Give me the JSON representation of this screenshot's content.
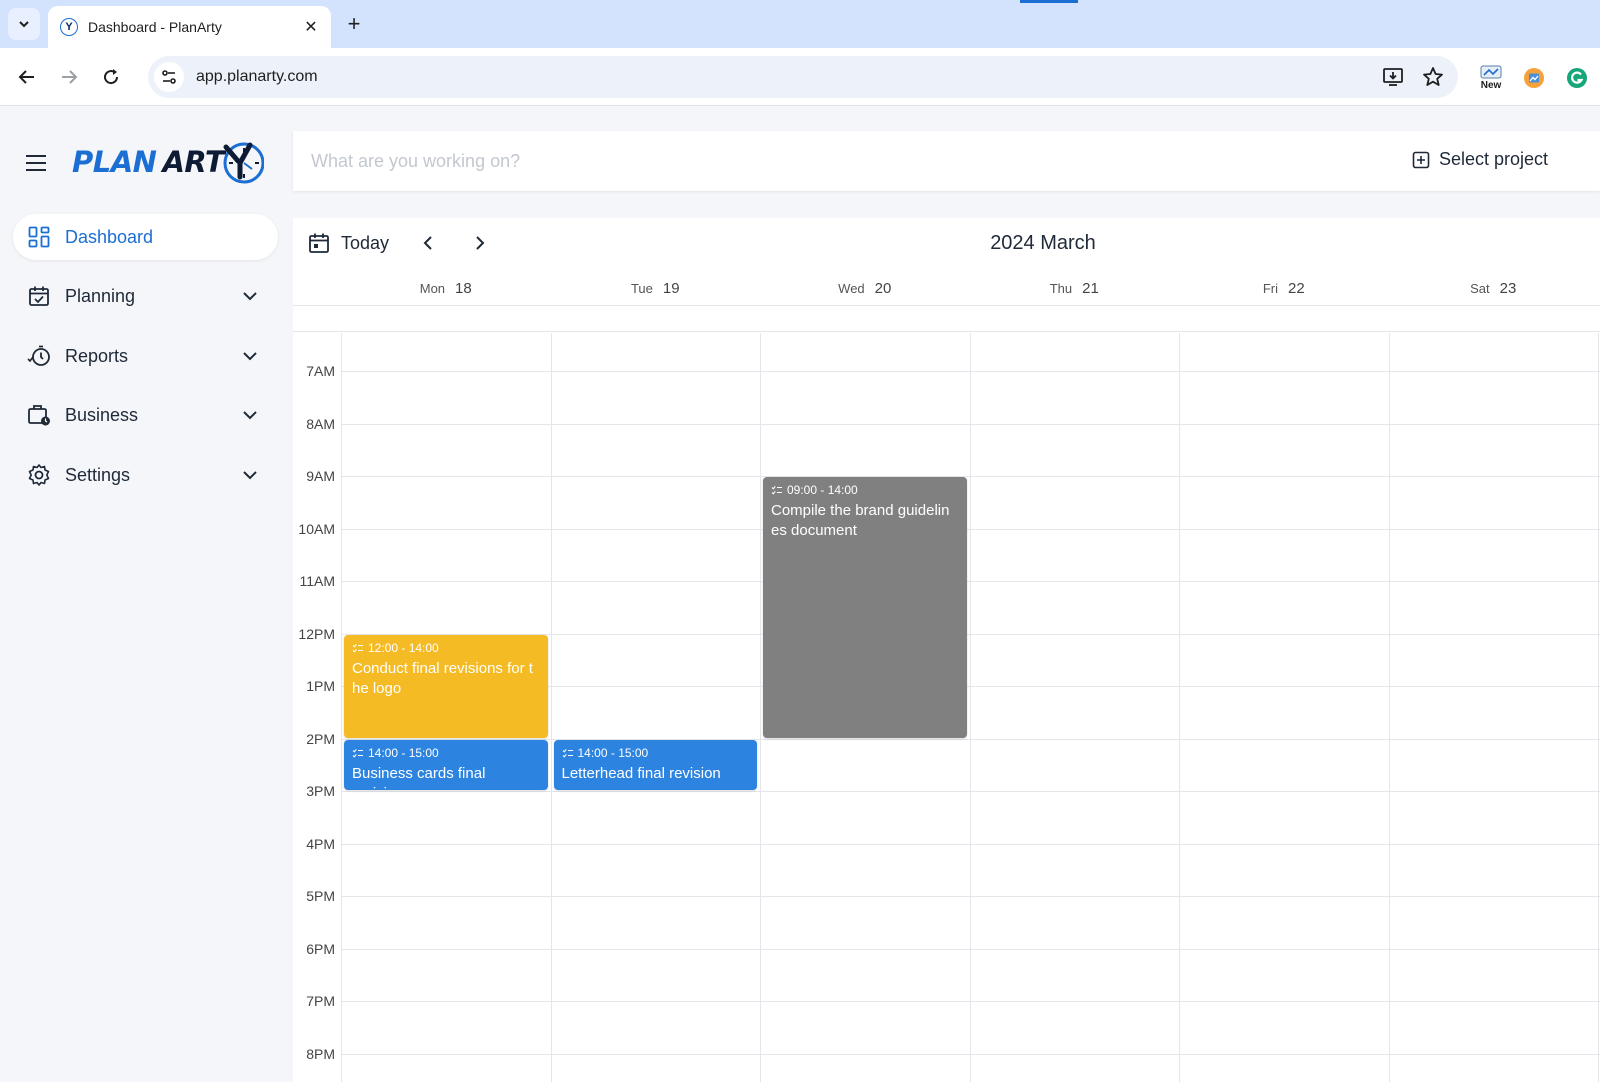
{
  "browser": {
    "tab_title": "Dashboard - PlanArty",
    "favicon_letter": "Y",
    "url": "app.planarty.com",
    "ext_new_label": "New"
  },
  "sidebar": {
    "logo_plan": "PLAN",
    "logo_arty": "ART",
    "items": [
      {
        "label": "Dashboard",
        "icon": "dashboard-icon",
        "active": true
      },
      {
        "label": "Planning",
        "icon": "calendar-check-icon"
      },
      {
        "label": "Reports",
        "icon": "stopwatch-icon"
      },
      {
        "label": "Business",
        "icon": "briefcase-clock-icon"
      },
      {
        "label": "Settings",
        "icon": "gear-icon"
      }
    ]
  },
  "timer": {
    "placeholder": "What are you working on?",
    "select_project": "Select project"
  },
  "calendar": {
    "today_label": "Today",
    "month_title": "2024 March",
    "days": [
      {
        "name": "Mon",
        "num": "18"
      },
      {
        "name": "Tue",
        "num": "19"
      },
      {
        "name": "Wed",
        "num": "20"
      },
      {
        "name": "Thu",
        "num": "21"
      },
      {
        "name": "Fri",
        "num": "22"
      },
      {
        "name": "Sat",
        "num": "23"
      }
    ],
    "hours": [
      "7AM",
      "8AM",
      "9AM",
      "10AM",
      "11AM",
      "12PM",
      "1PM",
      "2PM",
      "3PM",
      "4PM",
      "5PM",
      "6PM",
      "7PM",
      "8PM"
    ],
    "events": [
      {
        "day": 2,
        "start": 9,
        "end": 14,
        "time": "09:00 - 14:00",
        "title": "Compile the brand guidelin es document",
        "color": "#808080"
      },
      {
        "day": 0,
        "start": 12,
        "end": 14,
        "time": "12:00 - 14:00",
        "title": "Conduct final revisions for t he logo",
        "color": "#f5bb25"
      },
      {
        "day": 0,
        "start": 14,
        "end": 15,
        "time": "14:00 - 15:00",
        "title": "Business cards final revision",
        "color": "#2c83e0"
      },
      {
        "day": 1,
        "start": 14,
        "end": 15,
        "time": "14:00 - 15:00",
        "title": "Letterhead final revision",
        "color": "#2c83e0"
      }
    ]
  }
}
